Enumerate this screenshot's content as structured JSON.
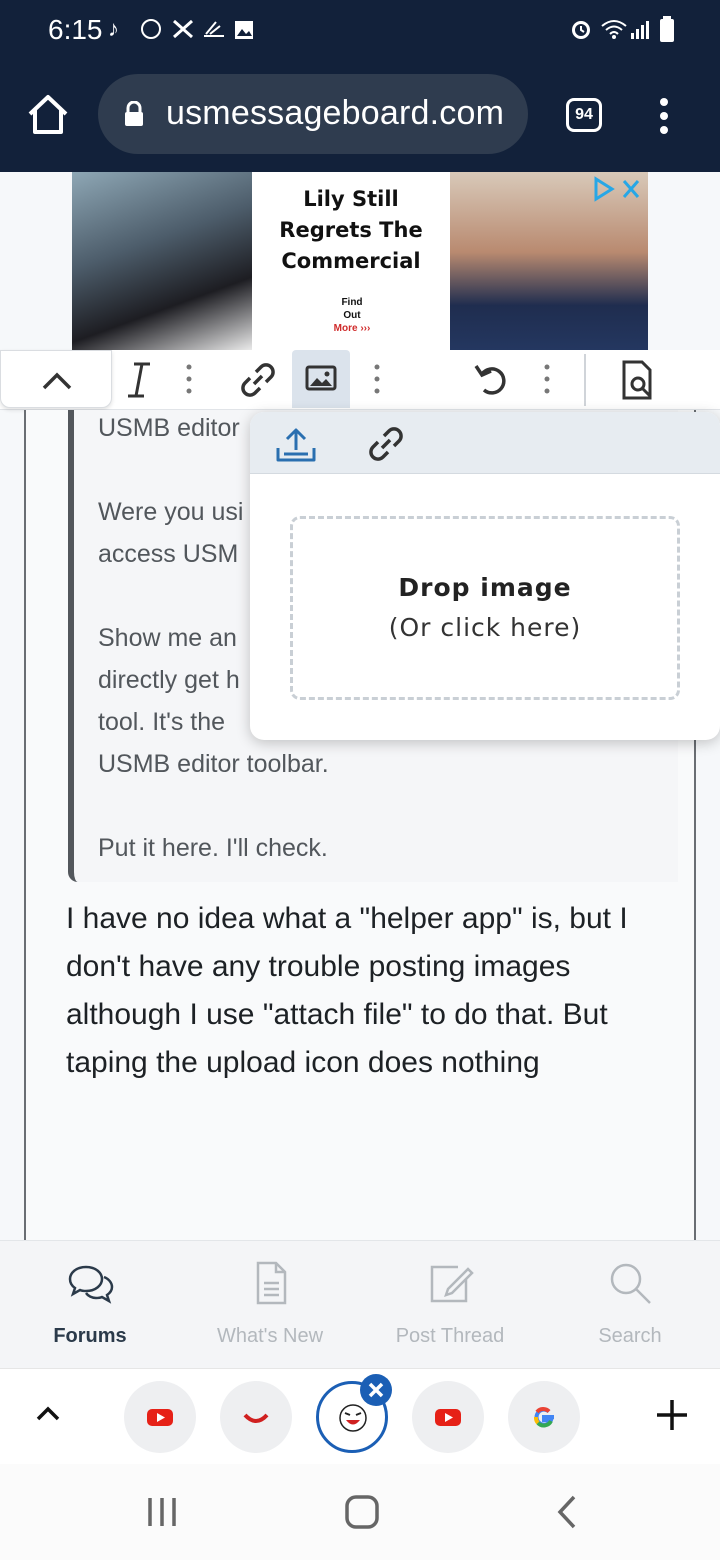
{
  "status_bar": {
    "time": "6:15"
  },
  "browser": {
    "url": "usmessageboard.com",
    "tab_count": "94"
  },
  "ad": {
    "headline_lines": [
      "Lily Still",
      "Regrets The",
      "Commercial"
    ],
    "cta_lines": [
      "Find",
      "Out",
      "More ›››"
    ]
  },
  "quote": {
    "lines": [
      "USMB editor",
      "Were you usi",
      "access USM",
      "Show me an",
      "directly get h",
      "tool.  It's the",
      "USMB editor toolbar.",
      "Put it here. I'll check."
    ]
  },
  "post": {
    "lines": [
      "I have no idea what a \"helper app\" is, but I",
      "don't have any trouble posting images",
      "although I use \"attach file\" to do that. But",
      "taping the upload icon does nothing"
    ]
  },
  "image_popup": {
    "drop_title": "Drop image",
    "drop_sub": "(Or click here)"
  },
  "bottom_nav": {
    "items": [
      {
        "label": "Forums",
        "icon": "forums-icon",
        "active": true
      },
      {
        "label": "What's New",
        "icon": "document-icon",
        "active": false
      },
      {
        "label": "Post Thread",
        "icon": "edit-icon",
        "active": false
      },
      {
        "label": "Search",
        "icon": "search-icon",
        "active": false
      }
    ]
  },
  "colors": {
    "chrome_bg": "#12213a",
    "accent": "#1b5fb5",
    "youtube_red": "#e62117"
  }
}
